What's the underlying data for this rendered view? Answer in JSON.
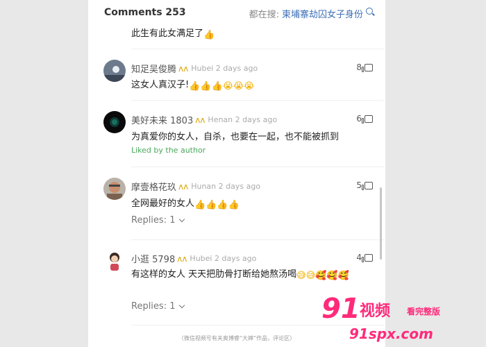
{
  "header": {
    "title": "Comments 253",
    "search_prefix": "都在搜:",
    "search_keyword": "柬埔寨劫囚女子身份"
  },
  "comments": [
    {
      "text": "此生有此女满足了",
      "emojis": "👍"
    },
    {
      "username": "知足吴俊腾",
      "meta": "Hubei 2 days ago",
      "likes": "8",
      "text": "这女人真汉子!",
      "emojis": "👍👍👍😭😭😭"
    },
    {
      "username": "美好未来 1803",
      "meta": "Henan 2 days ago",
      "likes": "6",
      "text": "为真爱你的女人，自杀，也要在一起，也不能被抓到",
      "liked_by_author": "Liked by the author"
    },
    {
      "username": "摩壹格花玖",
      "meta": "Hunan 2 days ago",
      "likes": "5",
      "text": "全网最好的女人",
      "emojis": "👍👍👍👍",
      "replies": "Replies: 1"
    },
    {
      "username": "小逛 5798",
      "meta": "Hubei 2 days ago",
      "likes": "4",
      "text": "有这样的女人 天天把肋骨打断给她熬汤喝",
      "emojis": "😅😅🥰🥰🥰",
      "replies": "Replies: 1"
    }
  ],
  "footer_note": "（微信视频号有关奥博睿“大婶”作品，评论区）",
  "watermark": {
    "digits": "91",
    "cn": "视频",
    "tag": "看完整版",
    "url": "91spx.com"
  },
  "colors": {
    "link_blue": "#3d6fb6",
    "liked_green": "#49a85b",
    "watermark_pink": "#ff2a7a"
  }
}
